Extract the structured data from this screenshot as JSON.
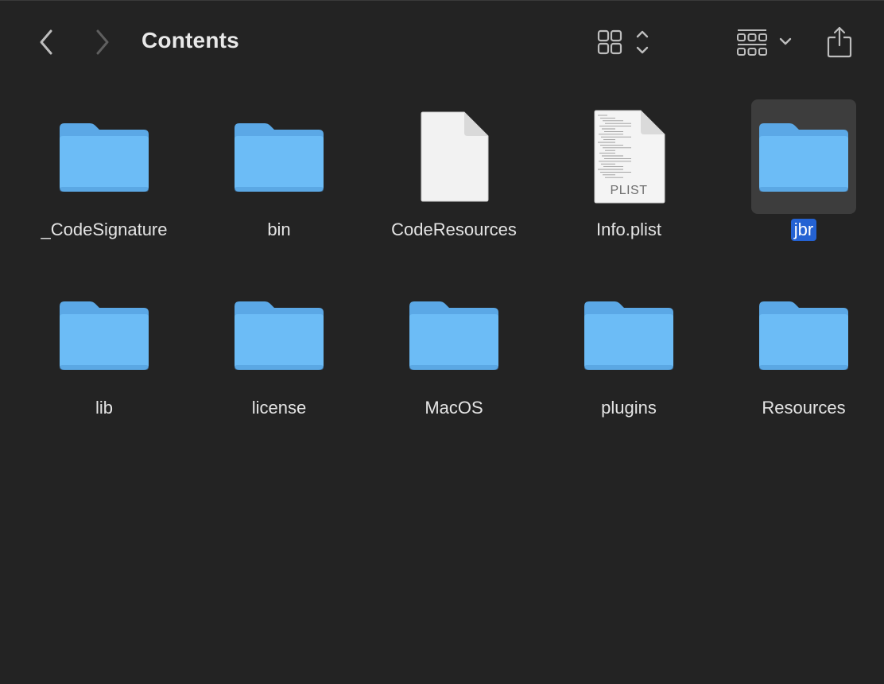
{
  "window": {
    "title": "Contents"
  },
  "toolbar": {
    "back_icon": "chevron-left-icon",
    "forward_icon": "chevron-right-icon",
    "view_icon": "icon-grid-icon",
    "group_icon": "group-grid-icon",
    "share_icon": "share-icon"
  },
  "items": [
    {
      "name": "_CodeSignature",
      "kind": "folder",
      "selected": false
    },
    {
      "name": "bin",
      "kind": "folder",
      "selected": false
    },
    {
      "name": "CodeResources",
      "kind": "document",
      "selected": false
    },
    {
      "name": "Info.plist",
      "kind": "plist",
      "badge": "PLIST",
      "selected": false
    },
    {
      "name": "jbr",
      "kind": "folder",
      "selected": true
    },
    {
      "name": "lib",
      "kind": "folder",
      "selected": false
    },
    {
      "name": "license",
      "kind": "folder",
      "selected": false
    },
    {
      "name": "MacOS",
      "kind": "folder",
      "selected": false
    },
    {
      "name": "plugins",
      "kind": "folder",
      "selected": false
    },
    {
      "name": "Resources",
      "kind": "folder",
      "selected": false
    }
  ],
  "colors": {
    "background": "#232323",
    "folder_front": "#6cbcf6",
    "folder_back": "#5ba8e6",
    "selection_label": "#2462d3",
    "selection_tile": "#3d3d3d"
  }
}
